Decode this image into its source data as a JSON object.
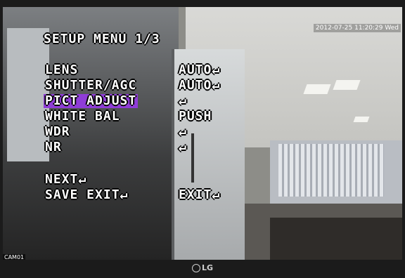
{
  "osd": {
    "title": "SETUP MENU 1/3",
    "timestamp": "2012-07-25 11:20:29 Wed",
    "camera_label": "CAM01",
    "items": [
      {
        "label": "LENS",
        "value": "AUTO↵"
      },
      {
        "label": "SHUTTER/AGC",
        "value": "AUTO↵"
      },
      {
        "label": "PICT ADJUST",
        "value": "↵"
      },
      {
        "label": "WHITE BAL",
        "value": "PUSH"
      },
      {
        "label": "WDR",
        "value": "↵"
      },
      {
        "label": "NR",
        "value": "↵"
      }
    ],
    "next_label": "NEXT↵",
    "save_exit_label": "SAVE EXIT↵",
    "save_exit_value": "EXIT↵",
    "highlight_color": "#8f3cd8"
  },
  "monitor": {
    "brand": "LG"
  }
}
